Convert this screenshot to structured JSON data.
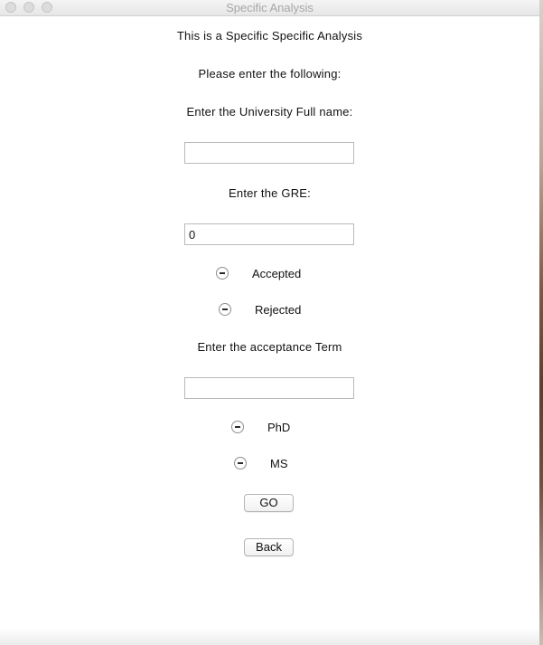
{
  "window": {
    "title": "Specific Analysis"
  },
  "form": {
    "heading": "This is a Specific Specific Analysis",
    "instruction": "Please enter the following:",
    "university_label": "Enter the University Full name:",
    "university_value": "",
    "gre_label": "Enter the GRE:",
    "gre_value": "0",
    "decision_options": [
      "Accepted",
      "Rejected"
    ],
    "term_label": "Enter the acceptance Term",
    "term_value": "",
    "degree_options": [
      "PhD",
      "MS"
    ],
    "go_label": "GO",
    "back_label": "Back"
  },
  "icons": {
    "radio_state": "indeterminate-radio-icon"
  }
}
